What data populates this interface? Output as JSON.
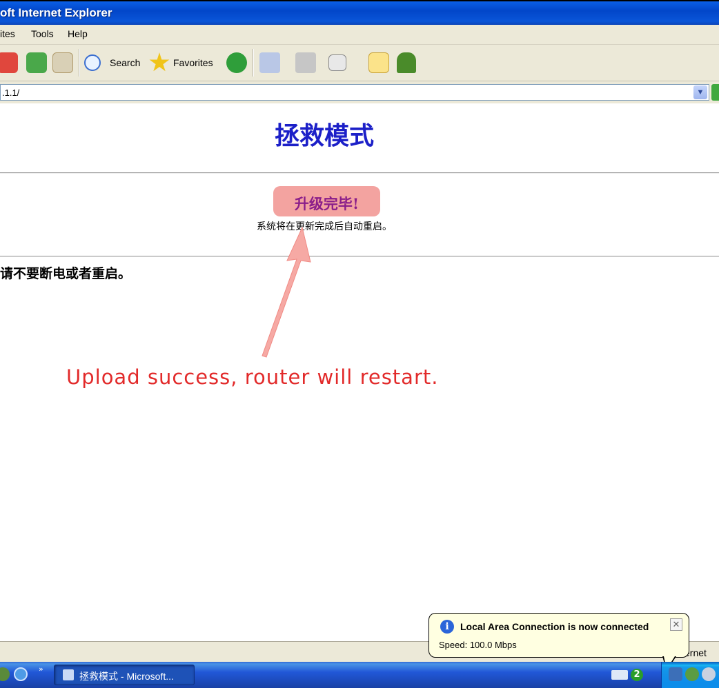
{
  "window": {
    "title": "oft Internet Explorer"
  },
  "menu": [
    "ites",
    "Tools",
    "Help"
  ],
  "toolbar": {
    "search_label": "Search",
    "favorites_label": "Favorites"
  },
  "address": {
    "value": ".1.1/"
  },
  "page": {
    "heading": "拯救模式",
    "badge": "升级完毕!",
    "subtitle": "系统将在更新完成后自动重启。",
    "warning": "请不要断电或者重启。"
  },
  "annotation": {
    "text": "Upload success, router will restart.",
    "color": "#e22a2a"
  },
  "status": {
    "zone": "ernet"
  },
  "taskbar": {
    "window_button": "拯救模式 - Microsoft...",
    "network_count": "2"
  },
  "balloon": {
    "title": "Local Area Connection is now connected",
    "body": "Speed: 100.0 Mbps"
  },
  "colors": {
    "heading": "#1c20c8",
    "badge_bg": "#f3a3a0",
    "badge_text": "#8a1e8a"
  }
}
